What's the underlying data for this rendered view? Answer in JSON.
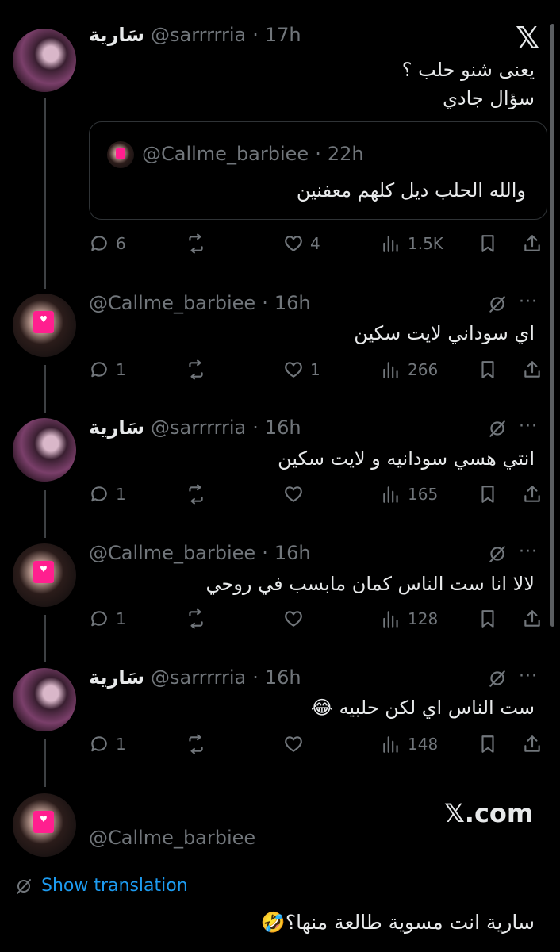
{
  "brand": {
    "x_logo": "𝕏",
    "watermark": "𝕏.com"
  },
  "tweets": [
    {
      "name": "سَارية",
      "handle": "@sarrrrria",
      "time": "17h",
      "lines": [
        "يعنى شنو حلب ؟",
        "سؤال جادي"
      ],
      "quote": {
        "handle": "@Callme_barbiee",
        "time": "22h",
        "text": "والله الحلب ديل كلهم معفنين"
      },
      "replies": "6",
      "reposts": "",
      "likes": "4",
      "views": "1.5K"
    },
    {
      "name": "",
      "handle": "@Callme_barbiee",
      "time": "16h",
      "lines": [
        "اي سوداني لايت سكين"
      ],
      "replies": "1",
      "reposts": "",
      "likes": "1",
      "views": "266"
    },
    {
      "name": "سَارية",
      "handle": "@sarrrrria",
      "time": "16h",
      "lines": [
        "انتي هسي سودانيه و لايت سكين"
      ],
      "replies": "1",
      "reposts": "",
      "likes": "",
      "views": "165"
    },
    {
      "name": "",
      "handle": "@Callme_barbiee",
      "time": "16h",
      "lines": [
        "لالا انا ست الناس كمان مابسب في روحي"
      ],
      "replies": "1",
      "reposts": "",
      "likes": "",
      "views": "128"
    },
    {
      "name": "سَارية",
      "handle": "@sarrrrria",
      "time": "16h",
      "lines": [
        "ست الناس اي لكن حلبيه 😂"
      ],
      "replies": "1",
      "reposts": "",
      "likes": "",
      "views": "148"
    }
  ],
  "final": {
    "handle": "@Callme_barbiee",
    "show_translation": "Show translation",
    "text": "سارية انت مسوية طالعة منها؟🤣"
  },
  "separator": "·",
  "icons": {
    "reply": "reply-icon",
    "repost": "repost-icon",
    "like": "like-icon",
    "views": "views-icon",
    "bookmark": "bookmark-icon",
    "share": "share-icon",
    "grok": "grok-icon",
    "more": "more-icon",
    "translate": "translate-icon"
  },
  "colors": {
    "background": "#000000",
    "text": "#e7e9ea",
    "muted": "#71767b",
    "link": "#1d9bf0",
    "line": "#3e4144",
    "accent_pink": "#ff1f8f"
  }
}
